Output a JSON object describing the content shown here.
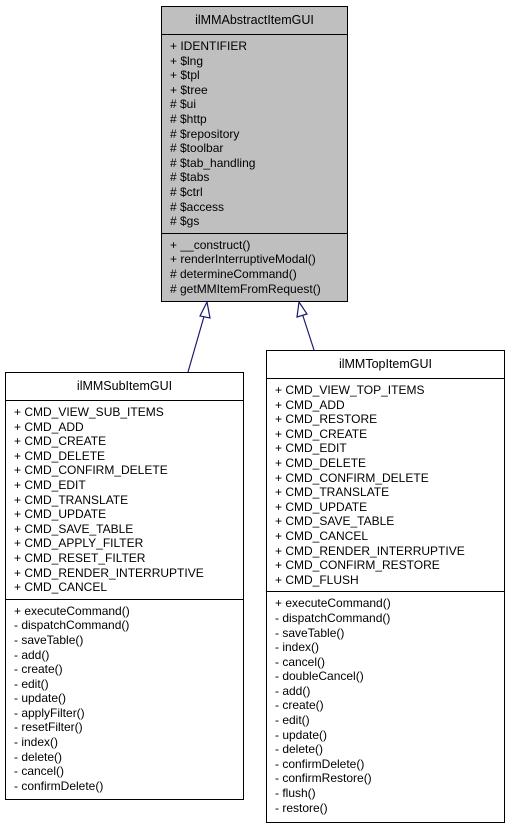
{
  "diagram": {
    "base_class": {
      "name": "ilMMAbstractItemGUI",
      "attributes": [
        "+ IDENTIFIER",
        "+ $lng",
        "+ $tpl",
        "+ $tree",
        "# $ui",
        "# $http",
        "# $repository",
        "# $toolbar",
        "# $tab_handling",
        "# $tabs",
        "# $ctrl",
        "# $access",
        "# $gs"
      ],
      "methods": [
        "+ __construct()",
        "+ renderInterruptiveModal()",
        "# determineCommand()",
        "# getMMItemFromRequest()"
      ]
    },
    "sub_item_class": {
      "name": "ilMMSubItemGUI",
      "attributes": [
        "+ CMD_VIEW_SUB_ITEMS",
        "+ CMD_ADD",
        "+ CMD_CREATE",
        "+ CMD_DELETE",
        "+ CMD_CONFIRM_DELETE",
        "+ CMD_EDIT",
        "+ CMD_TRANSLATE",
        "+ CMD_UPDATE",
        "+ CMD_SAVE_TABLE",
        "+ CMD_APPLY_FILTER",
        "+ CMD_RESET_FILTER",
        "+ CMD_RENDER_INTERRUPTIVE",
        "+ CMD_CANCEL"
      ],
      "methods": [
        "+ executeCommand()",
        "- dispatchCommand()",
        "- saveTable()",
        "- add()",
        "- create()",
        "- edit()",
        "- update()",
        "- applyFilter()",
        "- resetFilter()",
        "- index()",
        "- delete()",
        "- cancel()",
        "- confirmDelete()"
      ]
    },
    "top_item_class": {
      "name": "ilMMTopItemGUI",
      "attributes": [
        "+ CMD_VIEW_TOP_ITEMS",
        "+ CMD_ADD",
        "+ CMD_RESTORE",
        "+ CMD_CREATE",
        "+ CMD_EDIT",
        "+ CMD_DELETE",
        "+ CMD_CONFIRM_DELETE",
        "+ CMD_TRANSLATE",
        "+ CMD_UPDATE",
        "+ CMD_SAVE_TABLE",
        "+ CMD_CANCEL",
        "+ CMD_RENDER_INTERRUPTIVE",
        "+ CMD_CONFIRM_RESTORE",
        "+ CMD_FLUSH"
      ],
      "methods": [
        "+ executeCommand()",
        "- dispatchCommand()",
        "- saveTable()",
        "- index()",
        "- cancel()",
        "- doubleCancel()",
        "- add()",
        "- create()",
        "- edit()",
        "- update()",
        "- delete()",
        "- confirmDelete()",
        "- confirmRestore()",
        "- flush()",
        "- restore()"
      ]
    },
    "edges": [
      {
        "from": "ilMMSubItemGUI",
        "to": "ilMMAbstractItemGUI",
        "type": "inheritance"
      },
      {
        "from": "ilMMTopItemGUI",
        "to": "ilMMAbstractItemGUI",
        "type": "inheritance"
      }
    ],
    "edge_color": "#191970"
  }
}
